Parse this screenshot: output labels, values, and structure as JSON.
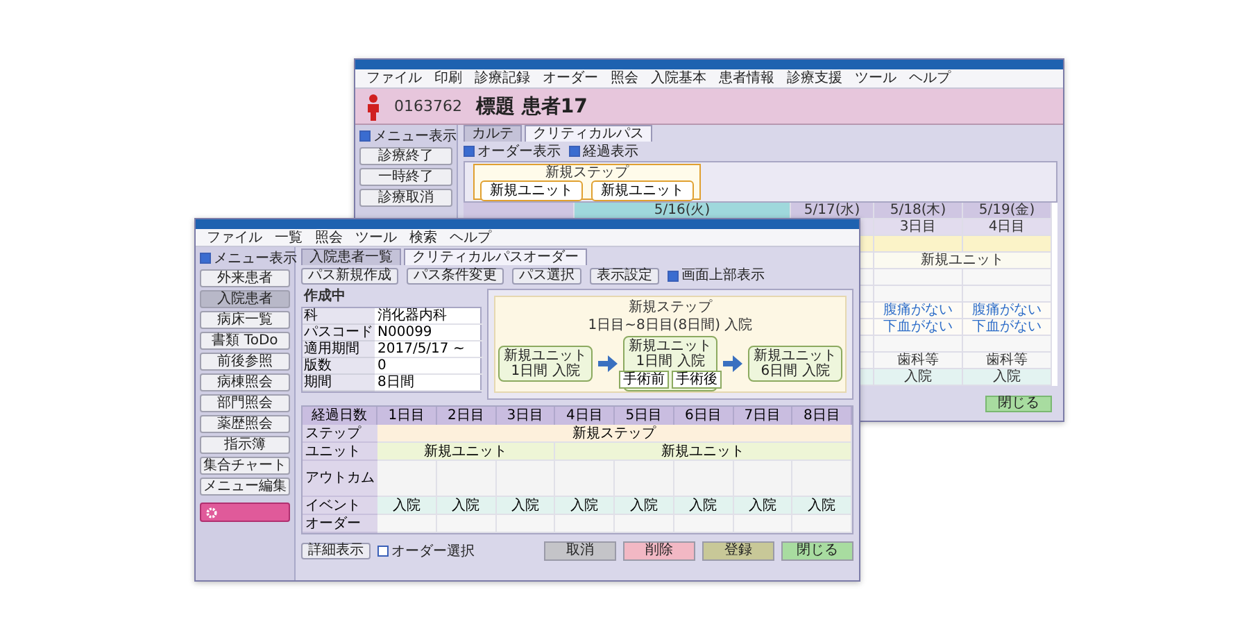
{
  "back_window": {
    "menu": [
      "ファイル",
      "印刷",
      "診療記録",
      "オーダー",
      "照会",
      "入院基本",
      "患者情報",
      "診療支援",
      "ツール",
      "ヘルプ"
    ],
    "patient": {
      "id": "0163762",
      "name": "標題 患者17"
    },
    "sidebar": {
      "menu_toggle": {
        "label": "メニュー表示",
        "checked": true
      },
      "buttons": [
        "診療終了",
        "一時終了",
        "診療取消"
      ]
    },
    "tabs": [
      {
        "label": "カルテ",
        "selected": false
      },
      {
        "label": "クリティカルパス",
        "selected": true
      }
    ],
    "options": [
      {
        "label": "オーダー表示",
        "checked": true
      },
      {
        "label": "経過表示",
        "checked": true
      }
    ],
    "flow": {
      "step": "新規ステップ",
      "units": [
        "新規ユニット",
        "新規ユニット"
      ]
    },
    "grid": {
      "columns": [
        {
          "date": "5/16(火)",
          "selected": true
        },
        {
          "date": "5/17(水)",
          "selected": false
        },
        {
          "date": "5/18(木)",
          "day": "3日目",
          "selected": false
        },
        {
          "date": "5/19(金)",
          "day": "4日目",
          "selected": false
        }
      ],
      "rows": [
        {
          "kind": "step"
        },
        {
          "kind": "unit",
          "cells": [
            "新規ユニット"
          ]
        },
        {
          "kind": "blank"
        },
        {
          "kind": "blank"
        },
        {
          "kind": "outcome",
          "cells": [
            "腹痛がない",
            "腹痛がない"
          ]
        },
        {
          "kind": "outcome",
          "cells": [
            "下血がない",
            "下血がない"
          ]
        },
        {
          "kind": "blank"
        },
        {
          "kind": "plain",
          "cells": [
            "歯科等",
            "歯科等"
          ]
        },
        {
          "kind": "event",
          "cells": [
            "入院",
            "入院"
          ]
        }
      ]
    },
    "close_button": "閉じる"
  },
  "front_window": {
    "menu": [
      "ファイル",
      "一覧",
      "照会",
      "ツール",
      "検索",
      "ヘルプ"
    ],
    "sidebar": {
      "menu_toggle": {
        "label": "メニュー表示",
        "checked": true
      },
      "buttons": [
        {
          "label": "外来患者",
          "selected": false
        },
        {
          "label": "入院患者",
          "selected": true
        },
        {
          "label": "病床一覧",
          "selected": false
        },
        {
          "label": "書類 ToDo",
          "selected": false
        },
        {
          "label": "前後参照",
          "selected": false
        },
        {
          "label": "病棟照会",
          "selected": false
        },
        {
          "label": "部門照会",
          "selected": false
        },
        {
          "label": "薬歴照会",
          "selected": false
        },
        {
          "label": "指示簿",
          "selected": false
        },
        {
          "label": "集合チャート",
          "selected": false
        },
        {
          "label": "メニュー編集",
          "selected": false
        }
      ]
    },
    "tabs": [
      {
        "label": "入院患者一覧",
        "selected": false
      },
      {
        "label": "クリティカルパスオーダー",
        "selected": true
      }
    ],
    "toolbar": {
      "buttons": [
        "パス新規作成",
        "パス条件変更",
        "パス選択",
        "表示設定"
      ],
      "option": {
        "label": "画面上部表示",
        "checked": true
      }
    },
    "info": {
      "status": "作成中",
      "rows": [
        {
          "key": "科",
          "value": "消化器内科"
        },
        {
          "key": "パスコード",
          "value": "N00099"
        },
        {
          "key": "適用期間",
          "value": "2017/5/17 ~"
        },
        {
          "key": "版数",
          "value": "0"
        },
        {
          "key": "期間",
          "value": "8日間"
        }
      ]
    },
    "flow": {
      "step": "新規ステップ",
      "period": "1日目~8日目(8日間) 入院",
      "units": [
        {
          "name": "新規ユニット",
          "detail": "1日間 入院"
        },
        {
          "name": "新規ユニット",
          "detail": "1日間 入院",
          "phases": [
            "手術前",
            "手術後"
          ]
        },
        {
          "name": "新規ユニット",
          "detail": "6日間 入院"
        }
      ]
    },
    "grid": {
      "header_label": "経過日数",
      "columns": [
        "1日目",
        "2日目",
        "3日目",
        "4日目",
        "5日目",
        "6日目",
        "7日目",
        "8日目"
      ],
      "rows": [
        {
          "label": "ステップ",
          "kind": "step",
          "cells": [
            "新規ステップ"
          ]
        },
        {
          "label": "ユニット",
          "kind": "unit",
          "cells": [
            "新規ユニット",
            "新規ユニット"
          ]
        },
        {
          "label": "アウトカム",
          "kind": "outcome"
        },
        {
          "label": "イベント",
          "kind": "event",
          "cells": [
            "入院",
            "入院",
            "入院",
            "入院",
            "入院",
            "入院",
            "入院",
            "入院"
          ]
        },
        {
          "label": "オーダー",
          "kind": "order"
        }
      ]
    },
    "footer": {
      "detail_button": "詳細表示",
      "option": {
        "label": "オーダー選択",
        "checked": false
      },
      "actions": [
        {
          "label": "取消",
          "kind": "cancel"
        },
        {
          "label": "削除",
          "kind": "delete"
        },
        {
          "label": "登録",
          "kind": "register"
        },
        {
          "label": "閉じる",
          "kind": "close"
        }
      ]
    }
  }
}
